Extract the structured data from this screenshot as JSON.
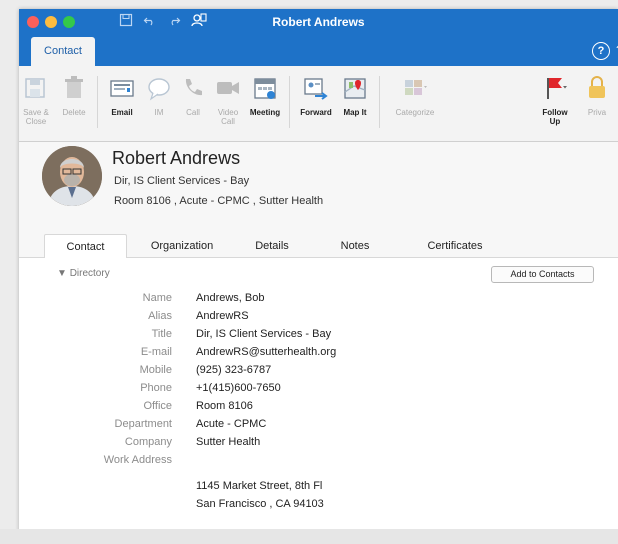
{
  "window": {
    "title": "Robert Andrews"
  },
  "ribbon": {
    "active_tab": "Contact",
    "buttons": [
      {
        "label": "Save & Close",
        "icon": "save-icon",
        "enabled": false
      },
      {
        "label": "Delete",
        "icon": "trash-icon",
        "enabled": false
      },
      {
        "label": "Email",
        "icon": "envelope-icon",
        "enabled": true
      },
      {
        "label": "IM",
        "icon": "chat-bubble-icon",
        "enabled": false
      },
      {
        "label": "Call",
        "icon": "phone-icon",
        "enabled": false
      },
      {
        "label": "Video Call",
        "icon": "video-camera-icon",
        "enabled": false
      },
      {
        "label": "Meeting",
        "icon": "calendar-icon",
        "enabled": true
      },
      {
        "label": "Forward",
        "icon": "forward-contact-icon",
        "enabled": true
      },
      {
        "label": "Map It",
        "icon": "map-icon",
        "enabled": true
      },
      {
        "label": "Categorize",
        "icon": "categorize-icon",
        "enabled": false
      },
      {
        "label": "Follow Up",
        "icon": "flag-icon",
        "enabled": true
      },
      {
        "label": "Priva",
        "icon": "lock-icon",
        "enabled": false
      }
    ]
  },
  "contact": {
    "display_name": "Robert Andrews",
    "job_title": "Dir, IS Client Services - Bay",
    "location": "Room 8106 ,  Acute - CPMC ,  Sutter Health"
  },
  "tabs": [
    "Contact",
    "Organization",
    "Details",
    "Notes",
    "Certificates"
  ],
  "directory": {
    "section_label": "Directory",
    "add_button": "Add to Contacts",
    "fields": [
      {
        "key": "Name",
        "value": "Andrews, Bob"
      },
      {
        "key": "Alias",
        "value": "AndrewRS"
      },
      {
        "key": "Title",
        "value": "Dir, IS Client Services - Bay"
      },
      {
        "key": "E-mail",
        "value": "AndrewRS@sutterhealth.org"
      },
      {
        "key": "Mobile",
        "value": "(925) 323-6787"
      },
      {
        "key": "Phone",
        "value": "+1(415)600-7650"
      },
      {
        "key": "Office",
        "value": "Room 8106"
      },
      {
        "key": "Department",
        "value": "Acute - CPMC"
      },
      {
        "key": "Company",
        "value": "Sutter Health"
      },
      {
        "key": "Work Address",
        "value": ""
      }
    ],
    "address_lines": [
      "1145 Market Street, 8th Fl",
      "San Francisco  ,  CA  94103"
    ]
  },
  "colors": {
    "titlebar": "#1e72c8",
    "accent_text": "#1e5fa8",
    "flag_red": "#e0262b"
  }
}
